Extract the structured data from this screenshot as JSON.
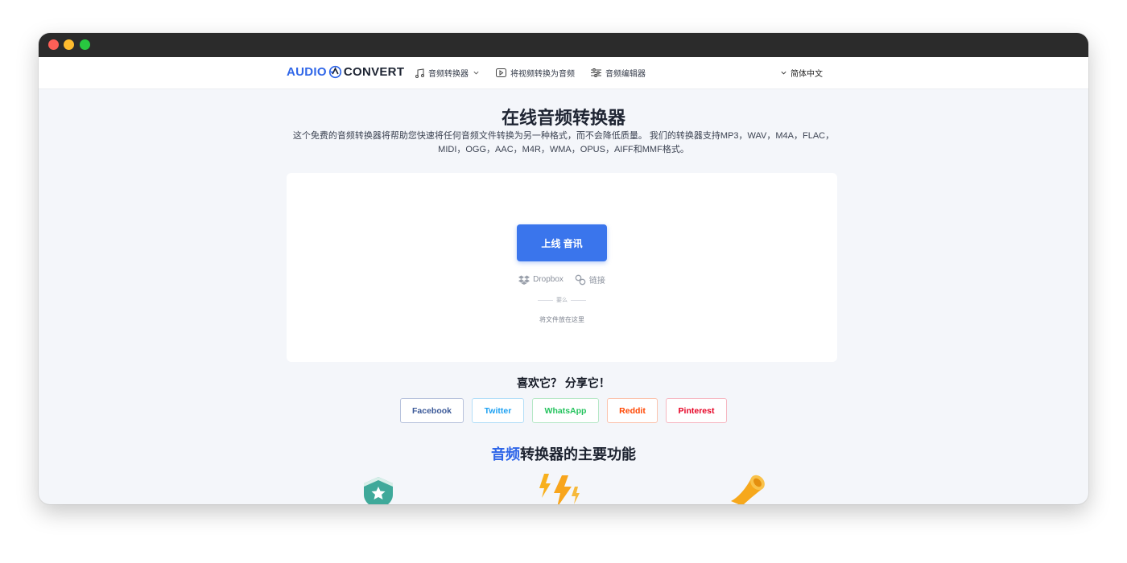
{
  "nav": {
    "logo_audio": "AUDIO",
    "logo_convert": "CONVERT",
    "items": [
      {
        "label": "音频转换器",
        "icon": "music-note-icon"
      },
      {
        "label": "将视频转换为音频",
        "icon": "play-icon"
      },
      {
        "label": "音频编辑器",
        "icon": "sliders-icon"
      }
    ],
    "language": "简体中文"
  },
  "main": {
    "title": "在线音频转换器",
    "description": "这个免费的音频转换器将帮助您快速将任何音频文件转换为另一种格式，而不会降低质量。 我们的转换器支持MP3，WAV，M4A，FLAC，MIDI，OGG，AAC，M4R，WMA，OPUS，AIFF和MMF格式。",
    "upload_label": "上线 音讯",
    "sources": [
      {
        "label": "Dropbox",
        "icon": "dropbox-icon"
      },
      {
        "label": "链接",
        "icon": "link-icon"
      }
    ],
    "or_label": "要么",
    "drop_hint": "将文件放在这里"
  },
  "share": {
    "title": "喜欢它？ 分享它！",
    "buttons": [
      "Facebook",
      "Twitter",
      "WhatsApp",
      "Reddit",
      "Pinterest"
    ]
  },
  "features": {
    "title_highlight": "音频",
    "title_rest": "转换器的主要功能",
    "icons": [
      "shield-star-icon",
      "lightning-icon",
      "megaphone-icon"
    ]
  },
  "colors": {
    "accent": "#3a75ec",
    "titlebar": "#2b2b2b",
    "page_bg": "#f4f6fa"
  }
}
